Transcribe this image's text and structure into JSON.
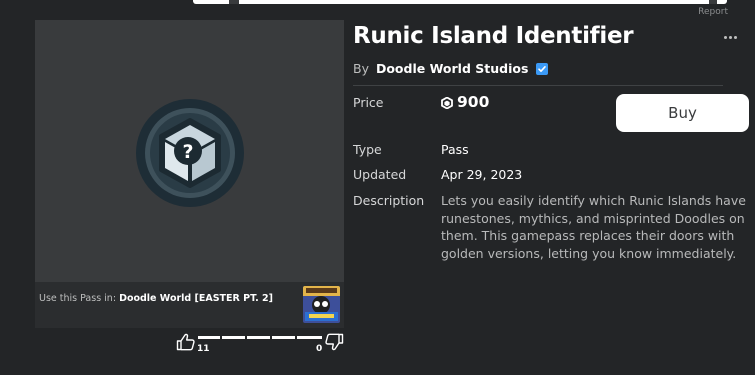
{
  "ad": {
    "report_label": "Report"
  },
  "item": {
    "title": "Runic Island Identifier",
    "by_label": "By",
    "creator": "Doodle World Studios",
    "more_icon": "ellipsis-icon"
  },
  "price": {
    "label": "Price",
    "value": "900",
    "currency_icon": "robux-icon"
  },
  "buy": {
    "label": "Buy"
  },
  "details": {
    "type_label": "Type",
    "type_value": "Pass",
    "updated_label": "Updated",
    "updated_value": "Apr 29, 2023",
    "description_label": "Description",
    "description_value": "Lets you easily identify which Runic Islands have runestones, mythics, and misprinted Doodles on them. This gamepass replaces their doors with golden versions, letting you know immediately."
  },
  "use_pass": {
    "prefix": "Use this Pass in:",
    "game_name": "Doodle World [EASTER PT. 2]"
  },
  "votes": {
    "upvotes": "11",
    "downvotes": "0",
    "upvote_fraction": 1.0
  },
  "colors": {
    "background": "#232527",
    "panel": "#393b3d",
    "buy_button": "#ffffff",
    "verified": "#3b9af6"
  }
}
